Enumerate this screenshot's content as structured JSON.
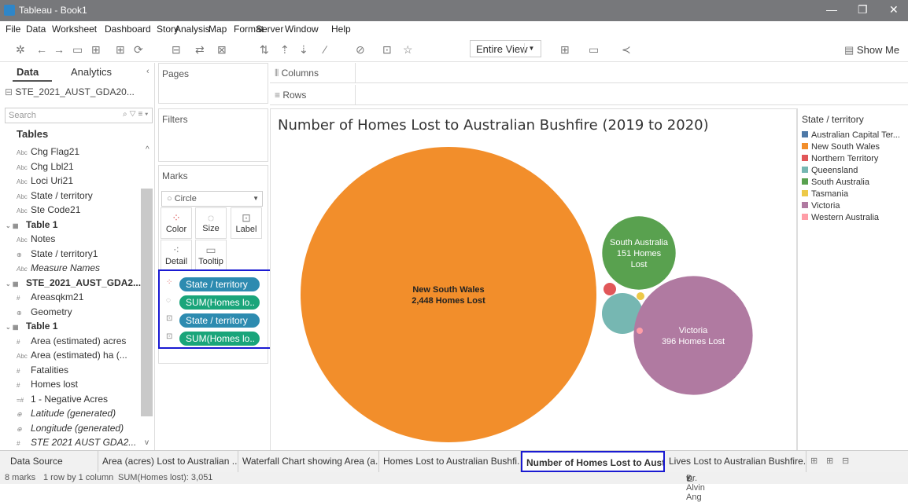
{
  "window": {
    "title": "Tableau - Book1"
  },
  "menu": [
    "File",
    "Data",
    "Worksheet",
    "Dashboard",
    "Story",
    "Analysis",
    "Map",
    "Format",
    "Server",
    "Window",
    "Help"
  ],
  "toolbar": {
    "view_select": "Entire View",
    "show_me": "Show Me"
  },
  "left": {
    "tab_data": "Data",
    "tab_analytics": "Analytics",
    "datasource": "STE_2021_AUST_GDA20...",
    "search_placeholder": "Search",
    "tables_header": "Tables",
    "fields": [
      {
        "label": "Chg Flag21",
        "icon": "Abc",
        "style": "normal"
      },
      {
        "label": "Chg Lbl21",
        "icon": "Abc",
        "style": "normal"
      },
      {
        "label": "Loci Uri21",
        "icon": "Abc",
        "style": "normal"
      },
      {
        "label": "State / territory",
        "icon": "Abc",
        "style": "normal"
      },
      {
        "label": "Ste Code21",
        "icon": "Abc",
        "style": "normal"
      },
      {
        "label": "Table 1",
        "icon": "table",
        "style": "bold"
      },
      {
        "label": "Notes",
        "icon": "Abc",
        "style": "normal"
      },
      {
        "label": "State / territory1",
        "icon": "globe",
        "style": "normal"
      },
      {
        "label": "Measure Names",
        "icon": "Abc",
        "style": "ital"
      },
      {
        "label": "STE_2021_AUST_GDA2...",
        "icon": "table",
        "style": "bold"
      },
      {
        "label": "Areasqkm21",
        "icon": "#",
        "style": "normal"
      },
      {
        "label": "Geometry",
        "icon": "globe",
        "style": "normal"
      },
      {
        "label": "Table 1",
        "icon": "table",
        "style": "bold"
      },
      {
        "label": "Area (estimated) acres",
        "icon": "#",
        "style": "normal"
      },
      {
        "label": "Area (estimated) ha (...",
        "icon": "Abc",
        "style": "normal"
      },
      {
        "label": "Fatalities",
        "icon": "#",
        "style": "normal"
      },
      {
        "label": "Homes lost",
        "icon": "#",
        "style": "normal"
      },
      {
        "label": "1 - Negative Acres",
        "icon": "=#",
        "style": "normal"
      },
      {
        "label": "Latitude (generated)",
        "icon": "globe",
        "style": "ital"
      },
      {
        "label": "Longitude (generated)",
        "icon": "globe",
        "style": "ital"
      },
      {
        "label": "STE 2021 AUST GDA2...",
        "icon": "#",
        "style": "ital"
      }
    ]
  },
  "cards": {
    "pages": "Pages",
    "filters": "Filters",
    "marks": "Marks",
    "mark_type": "Circle"
  },
  "mark_buttons": {
    "color": "Color",
    "size": "Size",
    "label": "Label",
    "detail": "Detail",
    "tooltip": "Tooltip"
  },
  "pills": [
    "State / territory",
    "SUM(Homes lo..",
    "State / territory",
    "SUM(Homes lo.."
  ],
  "shelves": {
    "columns": "Columns",
    "rows": "Rows"
  },
  "chart_data": {
    "type": "packed-bubble",
    "title": "Number of Homes Lost to Australian Bushfire (2019 to 2020)",
    "categories": [
      "Australian Capital Territory",
      "New South Wales",
      "Northern Territory",
      "Queensland",
      "South Australia",
      "Tasmania",
      "Victoria",
      "Western Australia"
    ],
    "values": [
      null,
      2448,
      null,
      null,
      151,
      null,
      396,
      null
    ],
    "labels": [
      {
        "state": "New South Wales",
        "text": "2,448 Homes Lost"
      },
      {
        "state": "South Australia",
        "text": "151 Homes Lost"
      },
      {
        "state": "Victoria",
        "text": "396 Homes Lost"
      }
    ],
    "total": 3051
  },
  "legend": {
    "title": "State / territory",
    "items": [
      {
        "label": "Australian Capital Ter...",
        "color": "#4e79a7"
      },
      {
        "label": "New South Wales",
        "color": "#f28e2b"
      },
      {
        "label": "Northern Territory",
        "color": "#e15759"
      },
      {
        "label": "Queensland",
        "color": "#76b7b2"
      },
      {
        "label": "South Australia",
        "color": "#59a14f"
      },
      {
        "label": "Tasmania",
        "color": "#edc948"
      },
      {
        "label": "Victoria",
        "color": "#b07aa1"
      },
      {
        "label": "Western Australia",
        "color": "#ff9da7"
      }
    ]
  },
  "sheet_tabs": [
    {
      "label": "Data Source",
      "active": false
    },
    {
      "label": "Area (acres) Lost to Australian ...",
      "active": false
    },
    {
      "label": "Waterfall Chart showing Area (a...",
      "active": false
    },
    {
      "label": "Homes Lost to Australian Bushfi...",
      "active": false
    },
    {
      "label": "Number of Homes Lost to Aust...",
      "active": true
    },
    {
      "label": "Lives Lost to Australian Bushfire...",
      "active": false
    }
  ],
  "status": {
    "marks": "8 marks",
    "rows": "1 row by 1 column",
    "sum": "SUM(Homes lost): 3,051",
    "user": "Dr. Alvin Ang"
  }
}
